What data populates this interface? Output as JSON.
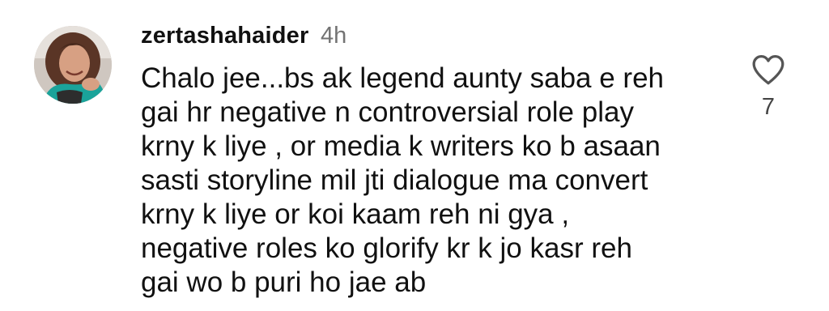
{
  "comment": {
    "username": "zertashahaider",
    "time": "4h",
    "lines": [
      "Chalo jee...bs ak legend aunty saba e reh",
      "gai hr negative n controversial role play",
      "krny k liye , or media k writers ko b asaan",
      "sasti storyline mil jti dialogue ma convert",
      "krny k liye or koi kaam reh ni gya ,",
      "negative roles ko glorify kr k jo kasr reh",
      "gai wo b puri ho jae ab"
    ],
    "like_icon": "heart-outline-icon",
    "like_count": "7"
  },
  "colors": {
    "text": "#111111",
    "muted": "#737373"
  }
}
